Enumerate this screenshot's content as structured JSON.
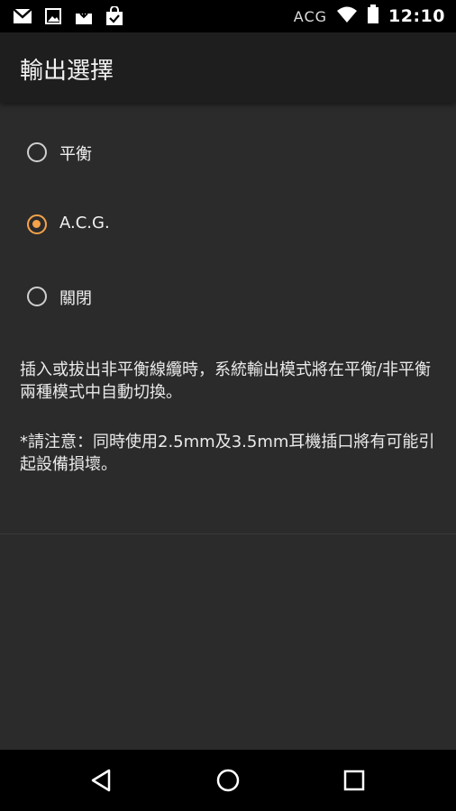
{
  "status_bar": {
    "carrier": "ACG",
    "time": "12:10",
    "icons": [
      "gmail-icon",
      "image-icon",
      "download-icon",
      "shop-bag-icon",
      "wifi-icon",
      "battery-icon"
    ]
  },
  "toolbar": {
    "title": "輸出選擇"
  },
  "options": [
    {
      "label": "平衡",
      "checked": false
    },
    {
      "label": "A.C.G.",
      "checked": true
    },
    {
      "label": "關閉",
      "checked": false
    }
  ],
  "description": {
    "line1": "插入或拔出非平衡線纜時，系統輸出模式將在平衡/非平衡兩種模式中自動切換。",
    "line2": "*請注意：同時使用2.5mm及3.5mm耳機插口將有可能引起設備損壞。"
  },
  "nav_bar": {
    "icons": [
      "back-icon",
      "home-icon",
      "recents-icon"
    ]
  },
  "colors": {
    "accent": "#f5a24a",
    "background": "#2b2b2b",
    "toolbar": "#1e1e1e"
  }
}
